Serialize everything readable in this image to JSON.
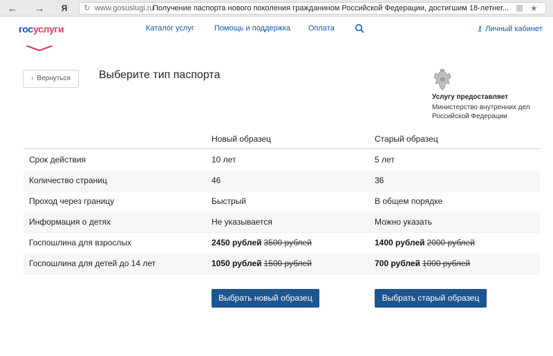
{
  "browser": {
    "back": "←",
    "forward": "→",
    "yandex": "Я",
    "reload": "↻",
    "domain": "www.gosuslugi.ru",
    "page_title": "Получение паспорта нового поколения гражданином Российской Федерации, достигшим 18-летнег...",
    "star": "★"
  },
  "header": {
    "logo_part1": "гос",
    "logo_part2": "услуги",
    "nav": [
      "Каталог услуг",
      "Помощь и поддержка",
      "Оплата"
    ],
    "cabinet_label": "Личный кабинет",
    "cabinet_icon": "⚷"
  },
  "page": {
    "back_label": "Вернуться",
    "back_icon": "‹",
    "title": "Выберите тип паспорта"
  },
  "provider": {
    "heading": "Услугу предоставляет",
    "line1": "Министерство внутренних дел",
    "line2": "Российской Федерации"
  },
  "table": {
    "columns": [
      "Новый образец",
      "Старый образец"
    ],
    "rows": [
      {
        "label": "Срок действия",
        "new": "10 лет",
        "old": "5 лет"
      },
      {
        "label": "Количество страниц",
        "new": "46",
        "old": "36"
      },
      {
        "label": "Проход через границу",
        "new": "Быстрый",
        "old": "В общем порядке"
      },
      {
        "label": "Информация о детях",
        "new": "Не указывается",
        "old": "Можно указать"
      },
      {
        "label": "Госпошлина для взрослых",
        "new_price": "2450 рублей",
        "new_old_price": "3500 рублей",
        "old_price": "1400 рублей",
        "old_old_price": "2000 рублей"
      },
      {
        "label": "Госпошлина для детей до 14 лет",
        "new_price": "1050 рублей",
        "new_old_price": "1500 рублей",
        "old_price": "700 рублей",
        "old_old_price": "1000 рублей"
      }
    ]
  },
  "actions": {
    "choose_new": "Выбрать новый образец",
    "choose_old": "Выбрать старый образец"
  },
  "colors": {
    "link": "#0d5ca8",
    "button": "#1c5590",
    "logo_blue": "#0d4cd3",
    "logo_red": "#ee3f58"
  }
}
